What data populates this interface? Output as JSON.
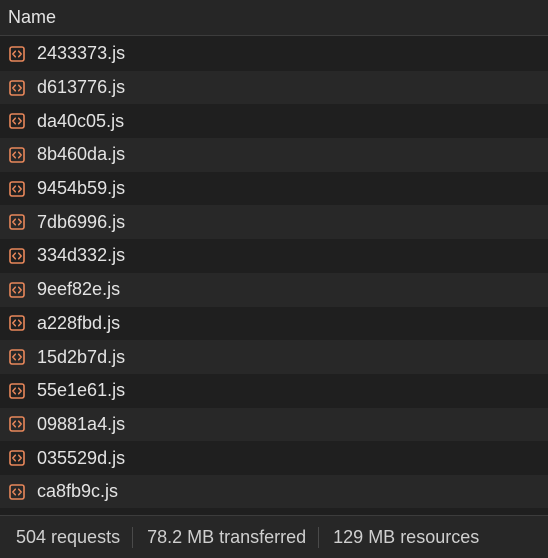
{
  "header": {
    "column_name": "Name"
  },
  "rows": [
    {
      "name": "2433373.js",
      "icon": "script-file-icon"
    },
    {
      "name": "d613776.js",
      "icon": "script-file-icon"
    },
    {
      "name": "da40c05.js",
      "icon": "script-file-icon"
    },
    {
      "name": "8b460da.js",
      "icon": "script-file-icon"
    },
    {
      "name": "9454b59.js",
      "icon": "script-file-icon"
    },
    {
      "name": "7db6996.js",
      "icon": "script-file-icon"
    },
    {
      "name": "334d332.js",
      "icon": "script-file-icon"
    },
    {
      "name": "9eef82e.js",
      "icon": "script-file-icon"
    },
    {
      "name": "a228fbd.js",
      "icon": "script-file-icon"
    },
    {
      "name": "15d2b7d.js",
      "icon": "script-file-icon"
    },
    {
      "name": "55e1e61.js",
      "icon": "script-file-icon"
    },
    {
      "name": "09881a4.js",
      "icon": "script-file-icon"
    },
    {
      "name": "035529d.js",
      "icon": "script-file-icon"
    },
    {
      "name": "ca8fb9c.js",
      "icon": "script-file-icon"
    }
  ],
  "status": {
    "requests": "504 requests",
    "transferred": "78.2 MB transferred",
    "resources": "129 MB resources"
  },
  "colors": {
    "icon_accent": "#e8875a",
    "background": "#1f1f1f",
    "row_alt": "#282828"
  }
}
